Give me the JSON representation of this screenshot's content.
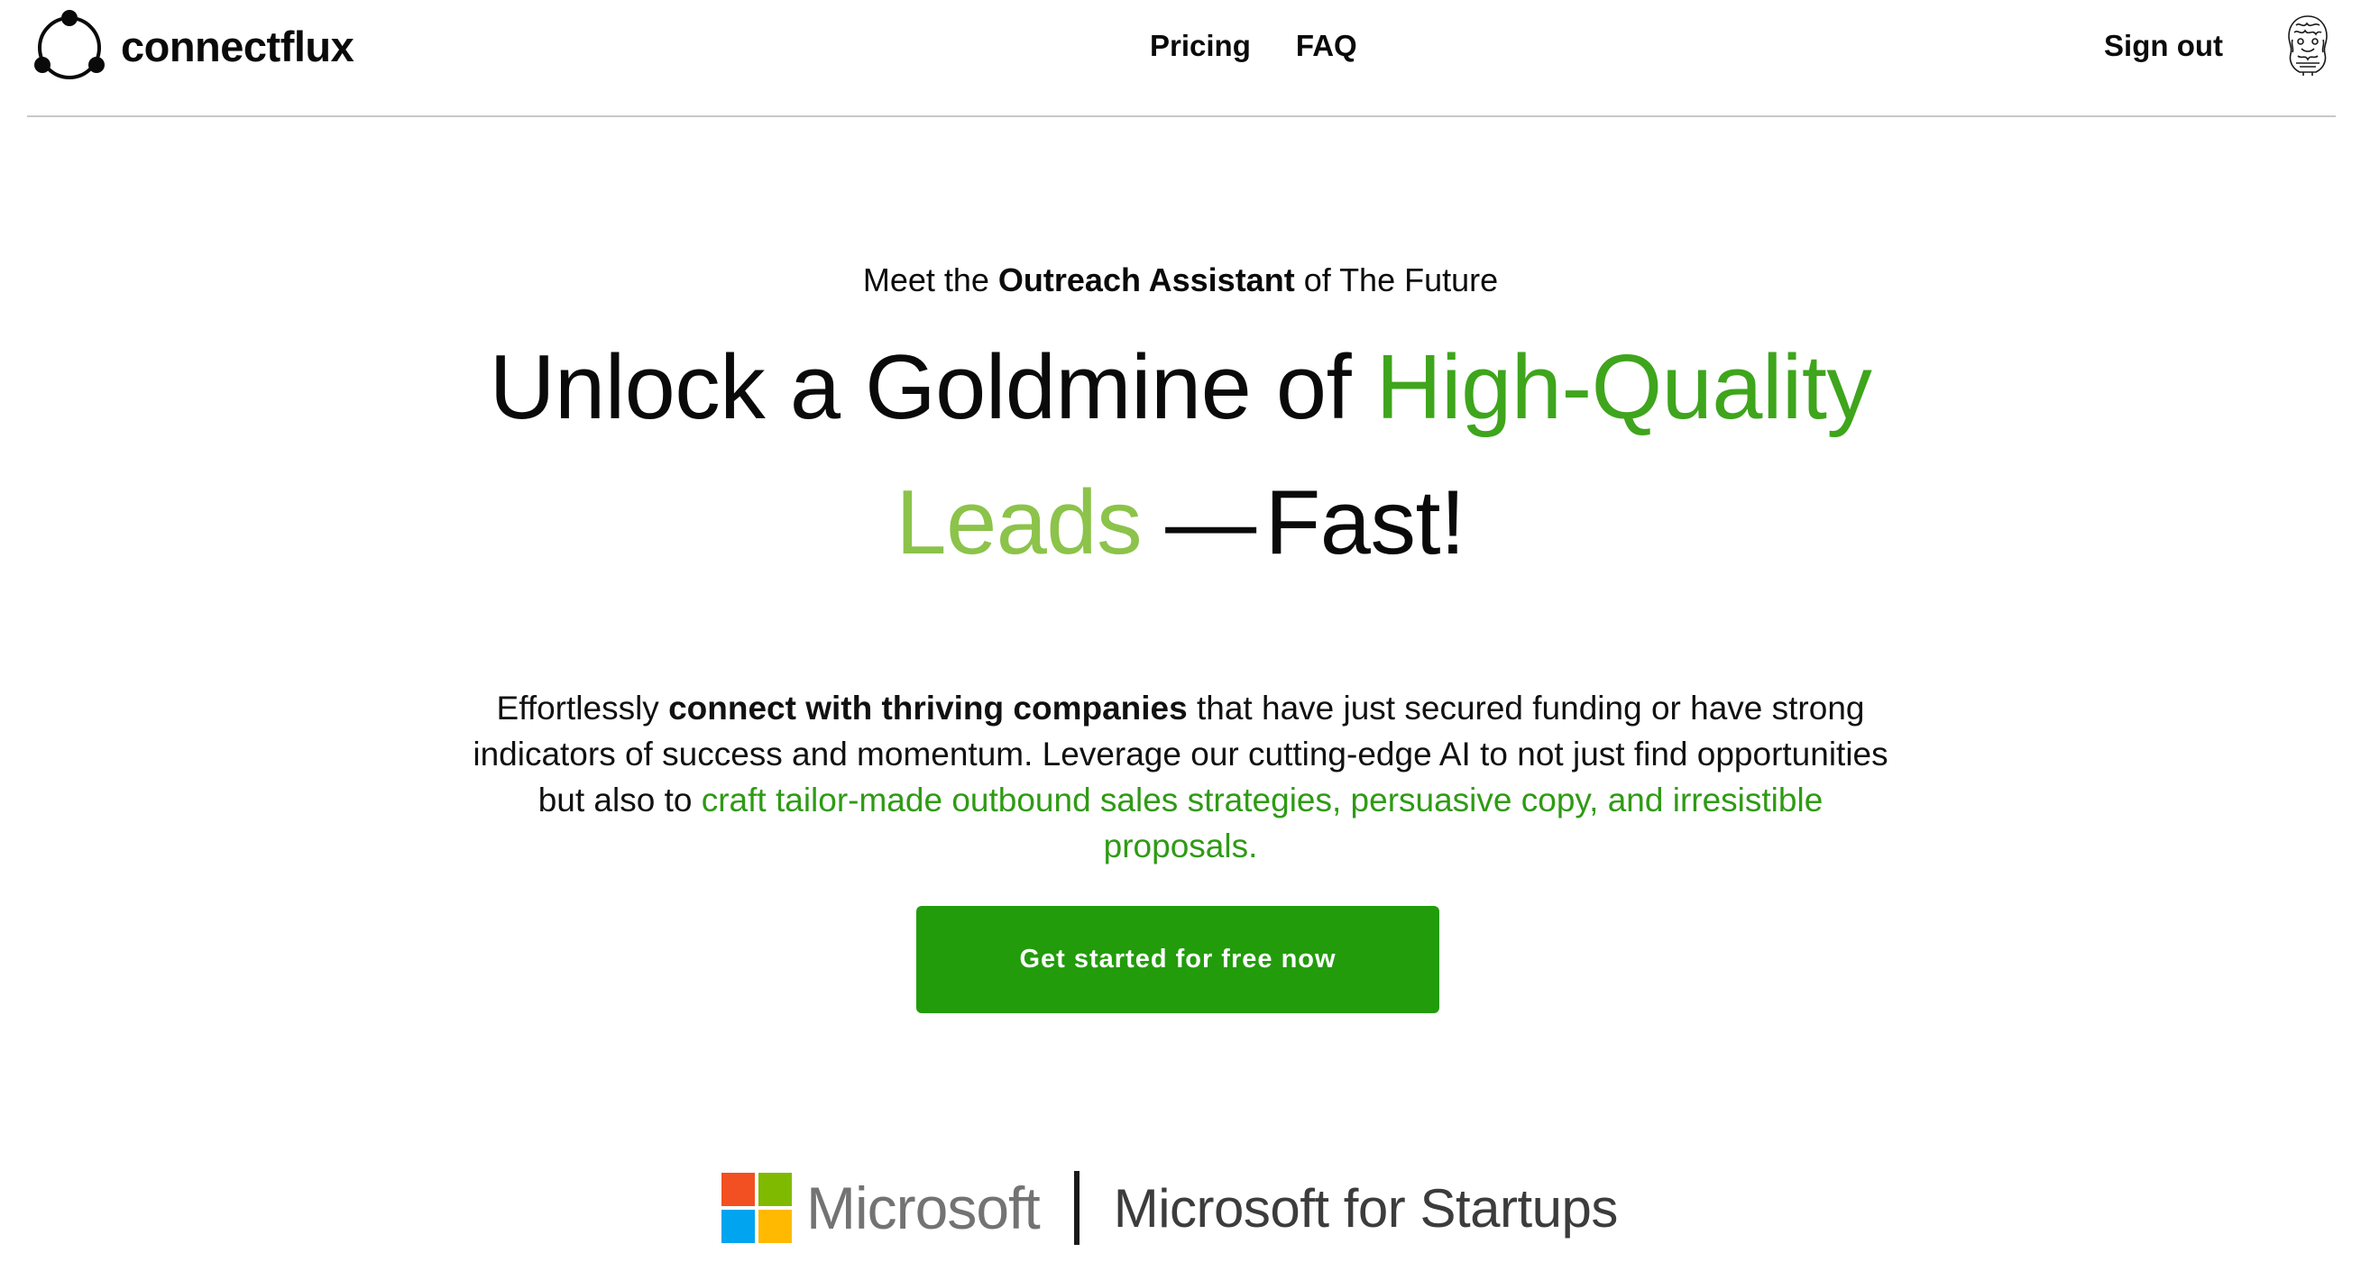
{
  "header": {
    "brand_name": "connectflux",
    "nav": [
      "Pricing",
      "FAQ"
    ],
    "sign_out_label": "Sign out",
    "avatar_icon": "ornate-avatar-icon"
  },
  "hero": {
    "eyebrow_prefix": "Meet the ",
    "eyebrow_bold": "Outreach Assistant",
    "eyebrow_suffix": " of The Future",
    "headline_part1": "Unlock a Goldmine of ",
    "headline_green": "High-Quality",
    "headline_light": "Leads",
    "headline_dash": "—",
    "headline_end": "Fast!",
    "description_part1": "Effortlessly ",
    "description_bold": "connect with thriving companies",
    "description_part2": " that have just secured funding or have strong indicators of success and momentum. Leverage our cutting-edge AI to not just find opportunities but also to ",
    "description_green": "craft tailor-made outbound sales strategies, persuasive copy, and irresistible proposals.",
    "cta_label": "Get started for free now"
  },
  "partner": {
    "logo_text": "Microsoft",
    "program_text": "Microsoft for Startups",
    "logo_colors": [
      "#f25022",
      "#7fba00",
      "#00a4ef",
      "#ffb900"
    ]
  },
  "colors": {
    "accent_green": "#3ea51c",
    "light_green": "#8cc34a",
    "cta_green": "#229c0b"
  }
}
